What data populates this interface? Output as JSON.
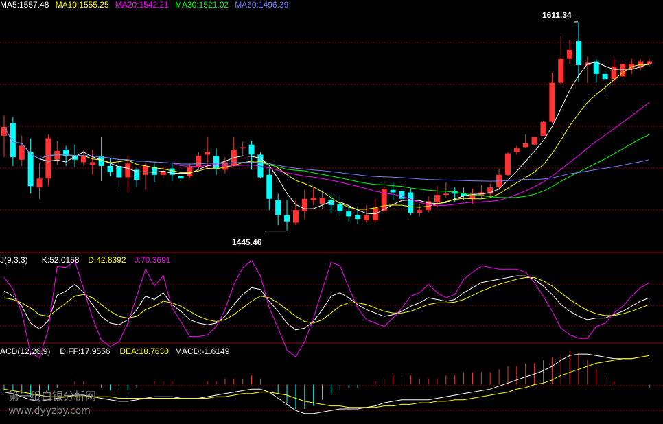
{
  "price_panel": {
    "legend": [
      {
        "text": "MA5:1557.48",
        "color": "#ffffff"
      },
      {
        "text": "MA10:1555.25",
        "color": "#ffff00"
      },
      {
        "text": "MA20:1542.21",
        "color": "#ff00ff"
      },
      {
        "text": "MA30:1521.02",
        "color": "#00ff00"
      },
      {
        "text": "MA60:1496.39",
        "color": "#7878ff"
      }
    ],
    "high_label": "1611.34",
    "low_label": "1445.46"
  },
  "kdj_panel": {
    "legend": [
      {
        "text": "J(9,3,3)",
        "color": "#ffffff"
      },
      {
        "text": "K:52.0158",
        "color": "#ffffff"
      },
      {
        "text": "D:42.8392",
        "color": "#ffff00"
      },
      {
        "text": "J:70.3691",
        "color": "#ff00ff"
      }
    ]
  },
  "macd_panel": {
    "legend": [
      {
        "text": "ACD(12,26,9)",
        "color": "#ffffff"
      },
      {
        "text": "DIFF:17.9556",
        "color": "#ffffff"
      },
      {
        "text": "DEA:18.7630",
        "color": "#ffff00"
      },
      {
        "text": "MACD:-1.6149",
        "color": "#ffffff"
      }
    ]
  },
  "watermark": {
    "title": "第一纸白银分析网",
    "url": "www.dyyzby.com"
  },
  "colors": {
    "background": "#000000",
    "up": "#ff3232",
    "down": "#00ffff",
    "grid": "#8b0000",
    "separator": "#b00000"
  },
  "chart_data": {
    "type": "candlestick",
    "price_range": [
      1430,
      1620
    ],
    "high_point": 1611.34,
    "low_point": 1445.46,
    "candles": [
      [
        1521,
        1528,
        1537,
        1504
      ],
      [
        1531,
        1504,
        1536,
        1497
      ],
      [
        1502,
        1513,
        1521,
        1497
      ],
      [
        1508,
        1481,
        1519,
        1475
      ],
      [
        1480,
        1487,
        1499,
        1471
      ],
      [
        1487,
        1519,
        1522,
        1481
      ],
      [
        1502,
        1509,
        1517,
        1498
      ],
      [
        1510,
        1505,
        1513,
        1497
      ],
      [
        1505,
        1502,
        1514,
        1496
      ],
      [
        1500,
        1505,
        1510,
        1497
      ],
      [
        1498,
        1500,
        1510,
        1490
      ],
      [
        1505,
        1497,
        1520,
        1485
      ],
      [
        1497,
        1492,
        1503,
        1489
      ],
      [
        1497,
        1488,
        1502,
        1480
      ],
      [
        1488,
        1499,
        1505,
        1476
      ],
      [
        1494,
        1486,
        1496,
        1480
      ],
      [
        1490,
        1497,
        1500,
        1478
      ],
      [
        1496,
        1490,
        1499,
        1484
      ],
      [
        1490,
        1493,
        1497,
        1487
      ],
      [
        1495,
        1490,
        1500,
        1485
      ],
      [
        1489,
        1487,
        1496,
        1486
      ],
      [
        1489,
        1496,
        1499,
        1488
      ],
      [
        1496,
        1505,
        1508,
        1494
      ],
      [
        1506,
        1508,
        1520,
        1495
      ],
      [
        1505,
        1495,
        1511,
        1490
      ],
      [
        1494,
        1500,
        1504,
        1491
      ],
      [
        1497,
        1510,
        1520,
        1496
      ],
      [
        1511,
        1512,
        1516,
        1505
      ],
      [
        1514,
        1506,
        1517,
        1494
      ],
      [
        1506,
        1488,
        1508,
        1487
      ],
      [
        1490,
        1471,
        1495,
        1462
      ],
      [
        1470,
        1458,
        1475,
        1450
      ],
      [
        1458,
        1453,
        1470,
        1446
      ],
      [
        1452,
        1462,
        1470,
        1450
      ],
      [
        1461,
        1471,
        1478,
        1455
      ],
      [
        1470,
        1472,
        1480,
        1466
      ],
      [
        1467,
        1472,
        1477,
        1463
      ],
      [
        1470,
        1466,
        1475,
        1460
      ],
      [
        1467,
        1461,
        1474,
        1457
      ],
      [
        1461,
        1457,
        1466,
        1453
      ],
      [
        1458,
        1455,
        1465,
        1451
      ],
      [
        1454,
        1458,
        1466,
        1452
      ],
      [
        1454,
        1464,
        1471,
        1452
      ],
      [
        1461,
        1479,
        1486,
        1461
      ],
      [
        1478,
        1476,
        1484,
        1470
      ],
      [
        1477,
        1471,
        1482,
        1467
      ],
      [
        1476,
        1460,
        1479,
        1458
      ],
      [
        1460,
        1462,
        1467,
        1457
      ],
      [
        1462,
        1469,
        1473,
        1460
      ],
      [
        1468,
        1474,
        1481,
        1464
      ],
      [
        1474,
        1475,
        1484,
        1472
      ],
      [
        1477,
        1475,
        1480,
        1468
      ],
      [
        1475,
        1473,
        1480,
        1470
      ],
      [
        1471,
        1475,
        1479,
        1467
      ],
      [
        1473,
        1476,
        1482,
        1472
      ],
      [
        1475,
        1480,
        1483,
        1473
      ],
      [
        1480,
        1490,
        1495,
        1478
      ],
      [
        1490,
        1507,
        1508,
        1489
      ],
      [
        1508,
        1511,
        1513,
        1506
      ],
      [
        1512,
        1515,
        1522,
        1511
      ],
      [
        1514,
        1520,
        1520,
        1514
      ],
      [
        1521,
        1532,
        1533,
        1521
      ],
      [
        1532,
        1563,
        1571,
        1531
      ],
      [
        1563,
        1582,
        1600,
        1561
      ],
      [
        1582,
        1589,
        1597,
        1578
      ],
      [
        1596,
        1577,
        1611,
        1564
      ],
      [
        1577,
        1579,
        1584,
        1563
      ],
      [
        1580,
        1570,
        1582,
        1563
      ],
      [
        1570,
        1566,
        1572,
        1554
      ],
      [
        1566,
        1576,
        1582,
        1563
      ],
      [
        1568,
        1578,
        1582,
        1566
      ],
      [
        1574,
        1578,
        1582,
        1570
      ],
      [
        1575,
        1580,
        1582,
        1573
      ],
      [
        1578,
        1580,
        1582,
        1576
      ]
    ],
    "kdj_range": [
      0,
      100
    ],
    "kdj": {
      "K": [
        60,
        54,
        42,
        22,
        15,
        25,
        55,
        60,
        68,
        58,
        44,
        30,
        22,
        20,
        26,
        38,
        54,
        50,
        58,
        44,
        36,
        26,
        22,
        20,
        22,
        30,
        44,
        56,
        64,
        62,
        48,
        36,
        22,
        14,
        16,
        24,
        38,
        54,
        58,
        52,
        44,
        38,
        34,
        30,
        32,
        36,
        42,
        46,
        52,
        50,
        48,
        50,
        58,
        64,
        70,
        72,
        74,
        76,
        78,
        78,
        74,
        66,
        56,
        44,
        36,
        30,
        26,
        28,
        28,
        32,
        36,
        42,
        48,
        52
      ],
      "D": [
        52,
        50,
        46,
        40,
        32,
        30,
        38,
        46,
        54,
        56,
        52,
        44,
        36,
        30,
        28,
        30,
        38,
        42,
        48,
        46,
        42,
        36,
        30,
        26,
        24,
        26,
        32,
        40,
        48,
        54,
        52,
        46,
        38,
        30,
        24,
        22,
        26,
        34,
        42,
        46,
        46,
        44,
        40,
        36,
        34,
        34,
        36,
        40,
        44,
        46,
        46,
        47,
        50,
        55,
        60,
        64,
        68,
        71,
        74,
        76,
        76,
        72,
        66,
        58,
        50,
        43,
        37,
        33,
        31,
        31,
        33,
        36,
        40,
        44
      ],
      "J": [
        76,
        62,
        34,
        -14,
        -19,
        15,
        89,
        88,
        96,
        62,
        28,
        2,
        -6,
        0,
        22,
        54,
        86,
        66,
        78,
        40,
        24,
        6,
        6,
        8,
        18,
        38,
        68,
        88,
        96,
        78,
        40,
        16,
        -10,
        -18,
        0,
        28,
        62,
        94,
        90,
        64,
        40,
        26,
        22,
        18,
        28,
        40,
        54,
        58,
        68,
        58,
        52,
        56,
        74,
        82,
        90,
        88,
        86,
        86,
        86,
        82,
        70,
        54,
        36,
        16,
        8,
        4,
        4,
        18,
        22,
        34,
        42,
        54,
        64,
        70
      ]
    },
    "macd_range": [
      -25,
      25
    ],
    "macd": {
      "DIFF": [
        -5,
        -6,
        -8,
        -10,
        -11,
        -10,
        -9,
        -8,
        -7,
        -7,
        -8,
        -9,
        -10,
        -11,
        -11,
        -10,
        -9,
        -8,
        -8,
        -8,
        -9,
        -9,
        -9,
        -8,
        -7,
        -6,
        -5,
        -4,
        -3,
        -3,
        -5,
        -9,
        -13,
        -17,
        -19,
        -19,
        -18,
        -17,
        -16,
        -16,
        -16,
        -15,
        -14,
        -12,
        -11,
        -10,
        -10,
        -10,
        -10,
        -9,
        -8,
        -7,
        -6,
        -5,
        -4,
        -3,
        -1,
        1,
        3,
        5,
        7,
        9,
        12,
        16,
        19,
        20,
        20,
        19,
        18,
        17,
        17,
        17,
        18,
        18
      ],
      "DEA": [
        -3,
        -4,
        -5,
        -6,
        -7,
        -8,
        -8,
        -8,
        -8,
        -8,
        -8,
        -8,
        -8,
        -9,
        -9,
        -9,
        -9,
        -9,
        -9,
        -9,
        -9,
        -9,
        -9,
        -9,
        -8,
        -8,
        -7,
        -6,
        -6,
        -5,
        -5,
        -6,
        -7,
        -9,
        -11,
        -12,
        -13,
        -14,
        -14,
        -15,
        -15,
        -15,
        -15,
        -14,
        -14,
        -13,
        -13,
        -12,
        -12,
        -11,
        -11,
        -10,
        -10,
        -9,
        -8,
        -7,
        -6,
        -5,
        -3,
        -2,
        0,
        1,
        3,
        6,
        8,
        10,
        12,
        14,
        15,
        16,
        17,
        17,
        18,
        19
      ],
      "MACD": [
        -4,
        -4,
        -6,
        -8,
        -8,
        -4,
        -2,
        0,
        2,
        2,
        0,
        -2,
        -4,
        -4,
        -4,
        -2,
        0,
        2,
        2,
        2,
        0,
        0,
        0,
        2,
        2,
        4,
        4,
        4,
        6,
        4,
        0,
        -6,
        -12,
        -16,
        -16,
        -14,
        -10,
        -6,
        -4,
        -2,
        -2,
        0,
        2,
        4,
        6,
        6,
        6,
        4,
        4,
        4,
        6,
        6,
        8,
        8,
        8,
        8,
        10,
        12,
        12,
        14,
        14,
        16,
        18,
        20,
        22,
        20,
        16,
        10,
        6,
        2,
        0,
        0,
        0,
        -2
      ]
    }
  }
}
